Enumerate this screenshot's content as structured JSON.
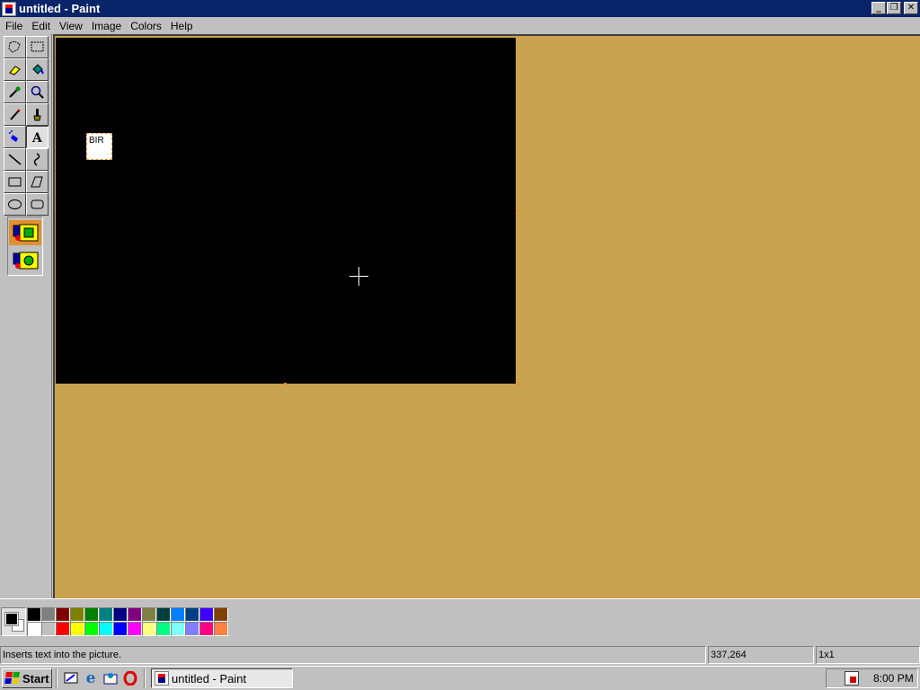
{
  "window": {
    "title": "untitled - Paint",
    "minimize": "_",
    "restore": "❐",
    "close": "✕"
  },
  "menu": [
    "File",
    "Edit",
    "View",
    "Image",
    "Colors",
    "Help"
  ],
  "tools": [
    {
      "name": "free-form-select-icon"
    },
    {
      "name": "select-icon"
    },
    {
      "name": "eraser-icon"
    },
    {
      "name": "fill-with-color-icon"
    },
    {
      "name": "pick-color-icon"
    },
    {
      "name": "magnifier-icon"
    },
    {
      "name": "pencil-icon"
    },
    {
      "name": "brush-icon"
    },
    {
      "name": "airbrush-icon"
    },
    {
      "name": "text-icon",
      "active": true
    },
    {
      "name": "line-icon"
    },
    {
      "name": "curve-icon"
    },
    {
      "name": "rectangle-icon"
    },
    {
      "name": "polygon-icon"
    },
    {
      "name": "ellipse-icon"
    },
    {
      "name": "rounded-rectangle-icon"
    }
  ],
  "tool_options": [
    "opaque-background-icon",
    "transparent-background-icon"
  ],
  "canvas": {
    "background": "#000000",
    "workspace": "#c9a24f",
    "text_content": "BIR"
  },
  "palette": {
    "foreground": "#000000",
    "background": "#ffffff",
    "row1": [
      "#000000",
      "#808080",
      "#800000",
      "#808000",
      "#008000",
      "#008080",
      "#000080",
      "#800080",
      "#808040",
      "#004040",
      "#0080ff",
      "#004080",
      "#4000ff",
      "#804000"
    ],
    "row2": [
      "#ffffff",
      "#c0c0c0",
      "#ff0000",
      "#ffff00",
      "#00ff00",
      "#00ffff",
      "#0000ff",
      "#ff00ff",
      "#ffff80",
      "#00ff80",
      "#80ffff",
      "#8080ff",
      "#ff0080",
      "#ff8040"
    ]
  },
  "status": {
    "message": "Inserts text into the picture.",
    "coords": "337,264",
    "size": "1x1"
  },
  "taskbar": {
    "start": "Start",
    "task": "untitled - Paint",
    "clock": "8:00 PM",
    "quick_launch": [
      "show-desktop-icon",
      "internet-explorer-icon",
      "outlook-icon",
      "opera-icon"
    ]
  }
}
